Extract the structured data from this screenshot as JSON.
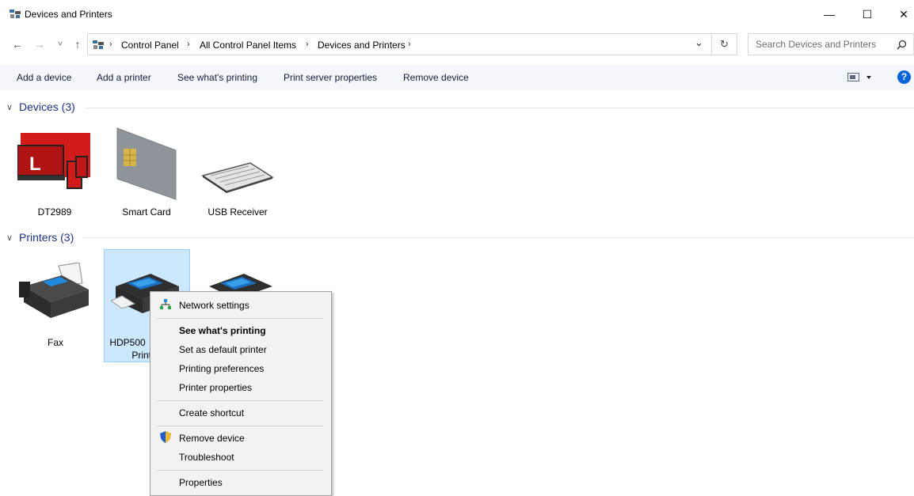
{
  "window": {
    "title": "Devices and Printers",
    "minimize_glyph": "—",
    "maximize_glyph": "☐",
    "close_glyph": "✕"
  },
  "nav": {
    "back_glyph": "←",
    "forward_glyph": "→",
    "recent_glyph": "˅",
    "up_glyph": "↑"
  },
  "address": {
    "crumbs": [
      "Control Panel",
      "All Control Panel Items",
      "Devices and Printers"
    ],
    "separator": "›",
    "dropdown_glyph": "⌄",
    "refresh_glyph": "↻"
  },
  "search": {
    "placeholder": "Search Devices and Printers",
    "icon": "search-icon"
  },
  "toolbar": {
    "add_device": "Add a device",
    "add_printer": "Add a printer",
    "see_printing": "See what's printing",
    "print_server": "Print server properties",
    "remove_device": "Remove device",
    "help_glyph": "?"
  },
  "groups": {
    "devices": {
      "header": "Devices (3)",
      "items": [
        "DT2989",
        "Smart Card",
        "USB Receiver"
      ]
    },
    "printers": {
      "header": "Printers (3)",
      "items": [
        "Fax",
        "HDP500",
        "Print"
      ]
    }
  },
  "context_menu": {
    "network_settings": "Network settings",
    "see_printing": "See what's printing",
    "set_default": "Set as default printer",
    "printing_prefs": "Printing preferences",
    "printer_props": "Printer properties",
    "create_shortcut": "Create shortcut",
    "remove_device": "Remove device",
    "troubleshoot": "Troubleshoot",
    "properties": "Properties"
  },
  "colors": {
    "accent_blue": "#1e3287",
    "selection": "#cce8ff",
    "laptop_red": "#d21b1b",
    "help_blue": "#0a64d8"
  }
}
